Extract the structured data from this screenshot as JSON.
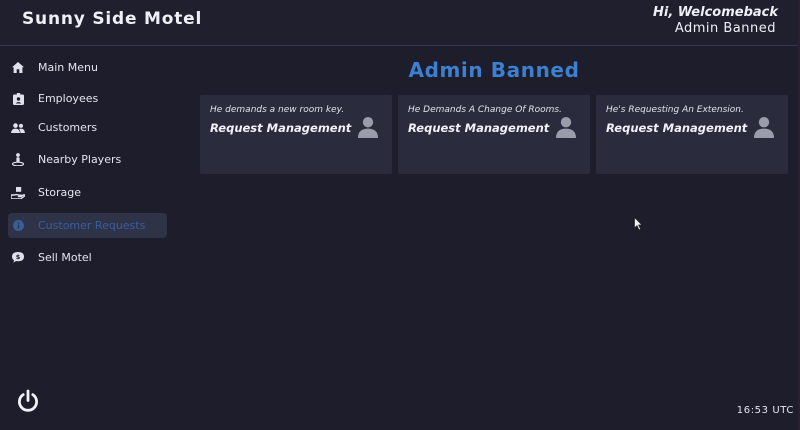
{
  "header": {
    "title": "Sunny Side Motel",
    "greeting": "Hi, Welcomeback",
    "username": "Admin Banned"
  },
  "sidebar": {
    "items": [
      {
        "label": "Main Menu",
        "icon": "home-icon",
        "active": false
      },
      {
        "label": "Employees",
        "icon": "id-badge-icon",
        "active": false
      },
      {
        "label": "Customers",
        "icon": "users-icon",
        "active": false
      },
      {
        "label": "Nearby Players",
        "icon": "person-pin-icon",
        "active": false
      },
      {
        "label": "Storage",
        "icon": "box-hand-icon",
        "active": false
      },
      {
        "label": "Customer Requests",
        "icon": "info-circle-icon",
        "active": true
      },
      {
        "label": "Sell Motel",
        "icon": "chat-dollar-icon",
        "active": false
      }
    ],
    "power_icon": "power-icon"
  },
  "main": {
    "title": "Admin Banned",
    "cards": [
      {
        "subtitle": "He demands a new room key.",
        "label": "Request Management",
        "icon": "user-icon"
      },
      {
        "subtitle": "He Demands A Change Of Rooms.",
        "label": "Request Management",
        "icon": "user-icon"
      },
      {
        "subtitle": "He's Requesting An Extension.",
        "label": "Request Management",
        "icon": "user-icon"
      }
    ]
  },
  "footer": {
    "clock": "16:53 UTC"
  },
  "colors": {
    "background": "#1d1d2b",
    "card": "#2a2b3d",
    "accent": "#3d7fd0",
    "active_item": "#2f3347"
  }
}
